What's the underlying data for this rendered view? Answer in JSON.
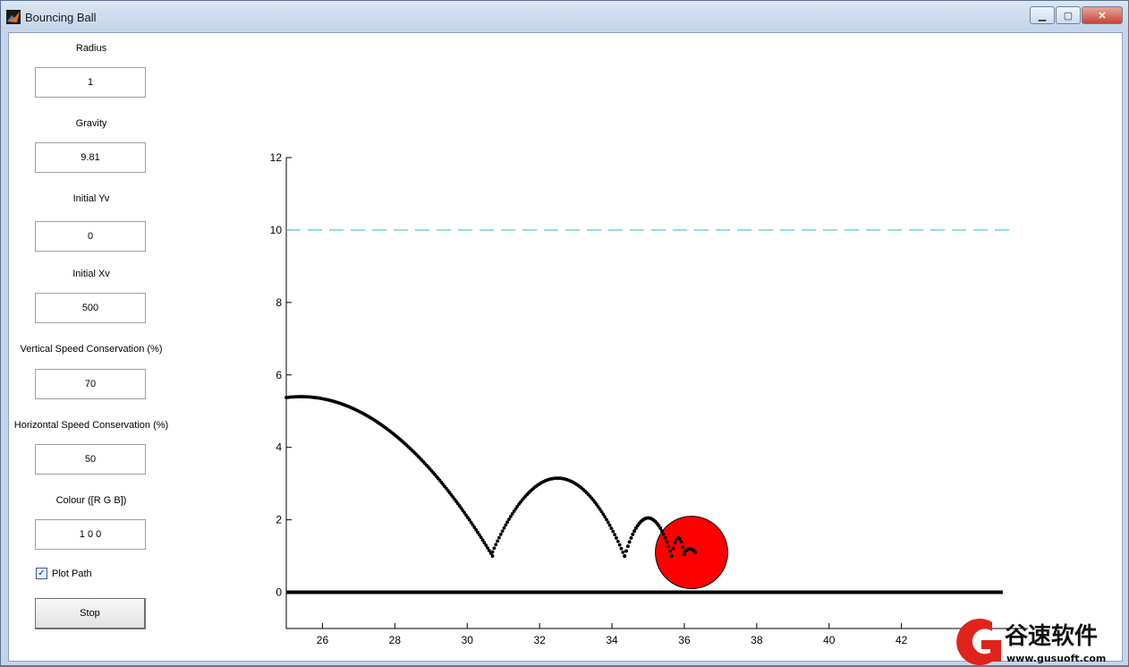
{
  "window": {
    "title": "Bouncing Ball",
    "minimize_icon": "minimize-icon",
    "maximize_icon": "maximize-icon",
    "close_icon": "close-icon"
  },
  "panel": {
    "fields": [
      {
        "label": "Radius",
        "value": "1"
      },
      {
        "label": "Gravity",
        "value": "9.81"
      },
      {
        "label": "Initial Yv",
        "value": "0"
      },
      {
        "label": "Initial Xv",
        "value": "500"
      },
      {
        "label": "Vertical Speed Conservation (%)",
        "value": "70"
      },
      {
        "label": "Horizontal Speed Conservation (%)",
        "value": "50"
      },
      {
        "label": "Colour ([R G B])",
        "value": "1 0 0"
      }
    ],
    "plot_path": {
      "label": "Plot Path",
      "checked": true
    },
    "stop_label": "Stop"
  },
  "chart_data": {
    "type": "scatter",
    "xlim": [
      25,
      45
    ],
    "ylim": [
      -1,
      12
    ],
    "xticks": [
      "26",
      "28",
      "30",
      "32",
      "34",
      "36",
      "38",
      "40",
      "42"
    ],
    "xtick_values": [
      26,
      28,
      30,
      32,
      34,
      36,
      38,
      40,
      42
    ],
    "yticks": [
      "0",
      "2",
      "4",
      "6",
      "8",
      "10",
      "12"
    ],
    "ytick_values": [
      0,
      2,
      4,
      6,
      8,
      10,
      12
    ],
    "ceiling_y": 10,
    "ceiling_color": "#39c8c8",
    "ground_y": 0,
    "ground_x": [
      25,
      44.8
    ],
    "ball": {
      "x": 36.2,
      "y": 1.1,
      "radius": 1,
      "color": "#ff0000"
    },
    "path_arcs": [
      {
        "x0": 25.0,
        "x1": 30.7,
        "apex_x": 25.4,
        "apex_y": 5.4,
        "y_end": 1.0
      },
      {
        "x0": 30.7,
        "x1": 34.35,
        "apex_x": 32.5,
        "apex_y": 3.15,
        "y_end": 1.0
      },
      {
        "x0": 34.35,
        "x1": 35.65,
        "apex_x": 35.0,
        "apex_y": 2.05,
        "y_end": 1.0
      },
      {
        "x0": 35.65,
        "x1": 36.0,
        "apex_x": 35.83,
        "apex_y": 1.5,
        "y_end": 1.05
      },
      {
        "x0": 36.0,
        "x1": 36.3,
        "apex_x": 36.15,
        "apex_y": 1.2,
        "y_end": 1.1
      }
    ]
  },
  "watermark": {
    "name": "谷速软件",
    "url": "www.gusuoft.com"
  }
}
